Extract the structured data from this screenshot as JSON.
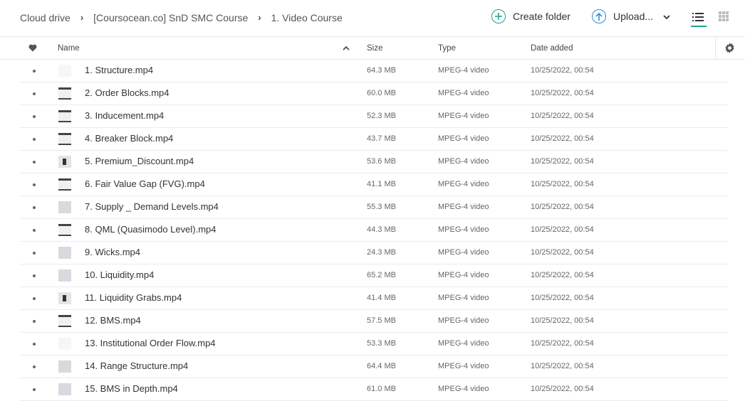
{
  "breadcrumb": {
    "items": [
      "Cloud drive",
      "[Coursocean.co] SnD SMC Course",
      "1. Video Course"
    ]
  },
  "toolbar": {
    "create_folder_label": "Create folder",
    "upload_label": "Upload..."
  },
  "columns": {
    "name": "Name",
    "size": "Size",
    "type": "Type",
    "date_added": "Date added"
  },
  "colors": {
    "accent_green": "#19a68a",
    "accent_blue": "#2d8fd6"
  },
  "files": [
    {
      "name": "1. Structure.mp4",
      "size": "64.3 MB",
      "type": "MPEG-4 video",
      "date": "10/25/2022, 00:54",
      "thumb": "pale"
    },
    {
      "name": "2. Order Blocks.mp4",
      "size": "60.0 MB",
      "type": "MPEG-4 video",
      "date": "10/25/2022, 00:54",
      "thumb": "dark"
    },
    {
      "name": "3. Inducement.mp4",
      "size": "52.3 MB",
      "type": "MPEG-4 video",
      "date": "10/25/2022, 00:54",
      "thumb": "dark"
    },
    {
      "name": "4. Breaker Block.mp4",
      "size": "43.7 MB",
      "type": "MPEG-4 video",
      "date": "10/25/2022, 00:54",
      "thumb": "dark"
    },
    {
      "name": "5. Premium_Discount.mp4",
      "size": "53.6 MB",
      "type": "MPEG-4 video",
      "date": "10/25/2022, 00:54",
      "thumb": "blk"
    },
    {
      "name": "6. Fair Value Gap (FVG).mp4",
      "size": "41.1 MB",
      "type": "MPEG-4 video",
      "date": "10/25/2022, 00:54",
      "thumb": "dark"
    },
    {
      "name": "7. Supply _ Demand Levels.mp4",
      "size": "55.3 MB",
      "type": "MPEG-4 video",
      "date": "10/25/2022, 00:54",
      "thumb": "mid"
    },
    {
      "name": "8. QML (Quasimodo Level).mp4",
      "size": "44.3 MB",
      "type": "MPEG-4 video",
      "date": "10/25/2022, 00:54",
      "thumb": "dark"
    },
    {
      "name": "9. Wicks.mp4",
      "size": "24.3 MB",
      "type": "MPEG-4 video",
      "date": "10/25/2022, 00:54",
      "thumb": "mid"
    },
    {
      "name": "10. Liquidity.mp4",
      "size": "65.2 MB",
      "type": "MPEG-4 video",
      "date": "10/25/2022, 00:54",
      "thumb": "mid"
    },
    {
      "name": "11. Liquidity Grabs.mp4",
      "size": "41.4 MB",
      "type": "MPEG-4 video",
      "date": "10/25/2022, 00:54",
      "thumb": "blk"
    },
    {
      "name": "12. BMS.mp4",
      "size": "57.5 MB",
      "type": "MPEG-4 video",
      "date": "10/25/2022, 00:54",
      "thumb": "dark"
    },
    {
      "name": "13. Institutional Order Flow.mp4",
      "size": "53.3 MB",
      "type": "MPEG-4 video",
      "date": "10/25/2022, 00:54",
      "thumb": "pale"
    },
    {
      "name": "14. Range Structure.mp4",
      "size": "64.4 MB",
      "type": "MPEG-4 video",
      "date": "10/25/2022, 00:54",
      "thumb": "mid"
    },
    {
      "name": "15. BMS in Depth.mp4",
      "size": "61.0 MB",
      "type": "MPEG-4 video",
      "date": "10/25/2022, 00:54",
      "thumb": "mid"
    }
  ]
}
